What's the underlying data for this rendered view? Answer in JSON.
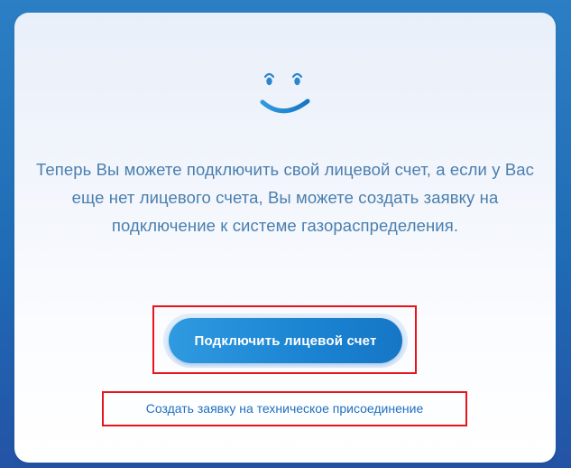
{
  "message": {
    "text": "Теперь Вы можете подключить свой лицевой счет, а если у Вас еще нет лицевого счета, Вы можете создать заявку на подключение к системе газораспределения."
  },
  "actions": {
    "connect_account_label": "Подключить лицевой счет",
    "tech_connection_link": "Создать заявку на техническое присоединение"
  },
  "icons": {
    "smiley": "smiley-face-icon"
  },
  "colors": {
    "accent": "#1a84d2",
    "text": "#4a7fae",
    "link": "#1f6fbf",
    "highlight": "#e8141b"
  }
}
